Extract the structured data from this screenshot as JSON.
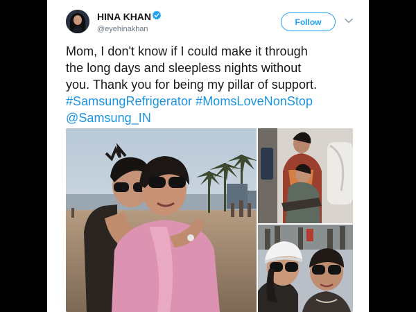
{
  "tweet": {
    "author": {
      "display_name": "HINA KHAN",
      "handle": "@eyehinakhan",
      "verified": true
    },
    "follow_label": "Follow",
    "text_lines": [
      "Mom, I don't know if I could make it through",
      "the long days and sleepless nights without",
      "you. Thank you for being my pillar of support."
    ],
    "hashtags": [
      "#SamsungRefrigerator",
      "#MomsLoveNonStop"
    ],
    "mention": "@Samsung_IN",
    "photo_count": 3
  },
  "colors": {
    "link": "#1b95e0",
    "follow_border": "#1da1f2",
    "verified": "#1da1f2",
    "text": "#14171a",
    "secondary_text": "#657786",
    "background_outer": "#000000"
  },
  "icons": {
    "verified": "verified-badge-icon",
    "more": "chevron-down-icon"
  }
}
